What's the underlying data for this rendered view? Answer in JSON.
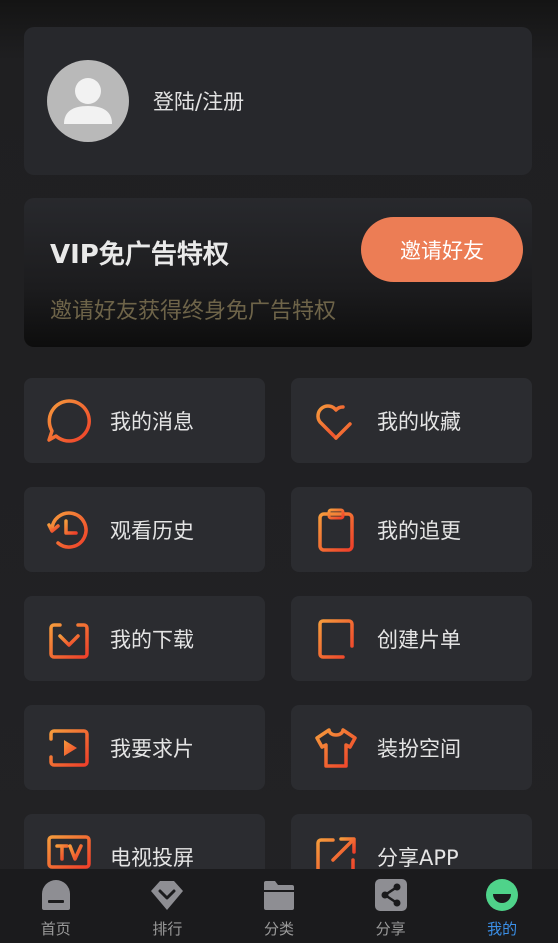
{
  "profile": {
    "login_label": "登陆/注册"
  },
  "vip": {
    "title": "VIP免广告特权",
    "subtitle": "邀请好友获得终身免广告特权",
    "invite_label": "邀请好友"
  },
  "menu": [
    {
      "label": "我的消息",
      "icon": "message-icon"
    },
    {
      "label": "我的收藏",
      "icon": "heart-plus-icon"
    },
    {
      "label": "观看历史",
      "icon": "history-icon"
    },
    {
      "label": "我的追更",
      "icon": "clipboard-icon"
    },
    {
      "label": "我的下载",
      "icon": "download-icon"
    },
    {
      "label": "创建片单",
      "icon": "create-list-icon"
    },
    {
      "label": "我要求片",
      "icon": "video-request-icon"
    },
    {
      "label": "装扮空间",
      "icon": "tshirt-icon"
    },
    {
      "label": "电视投屏",
      "icon": "tv-icon"
    },
    {
      "label": "分享APP",
      "icon": "share-out-icon"
    }
  ],
  "tabs": [
    {
      "label": "首页",
      "icon": "home-icon"
    },
    {
      "label": "排行",
      "icon": "ranking-icon"
    },
    {
      "label": "分类",
      "icon": "folder-icon"
    },
    {
      "label": "分享",
      "icon": "share-icon"
    },
    {
      "label": "我的",
      "icon": "profile-face-icon",
      "active": true
    }
  ],
  "colors": {
    "accent": "#ec7d55",
    "icon_gradient_start": "#f14c2e",
    "icon_gradient_end": "#f59a3c",
    "tab_active": "#3b8fe6"
  }
}
